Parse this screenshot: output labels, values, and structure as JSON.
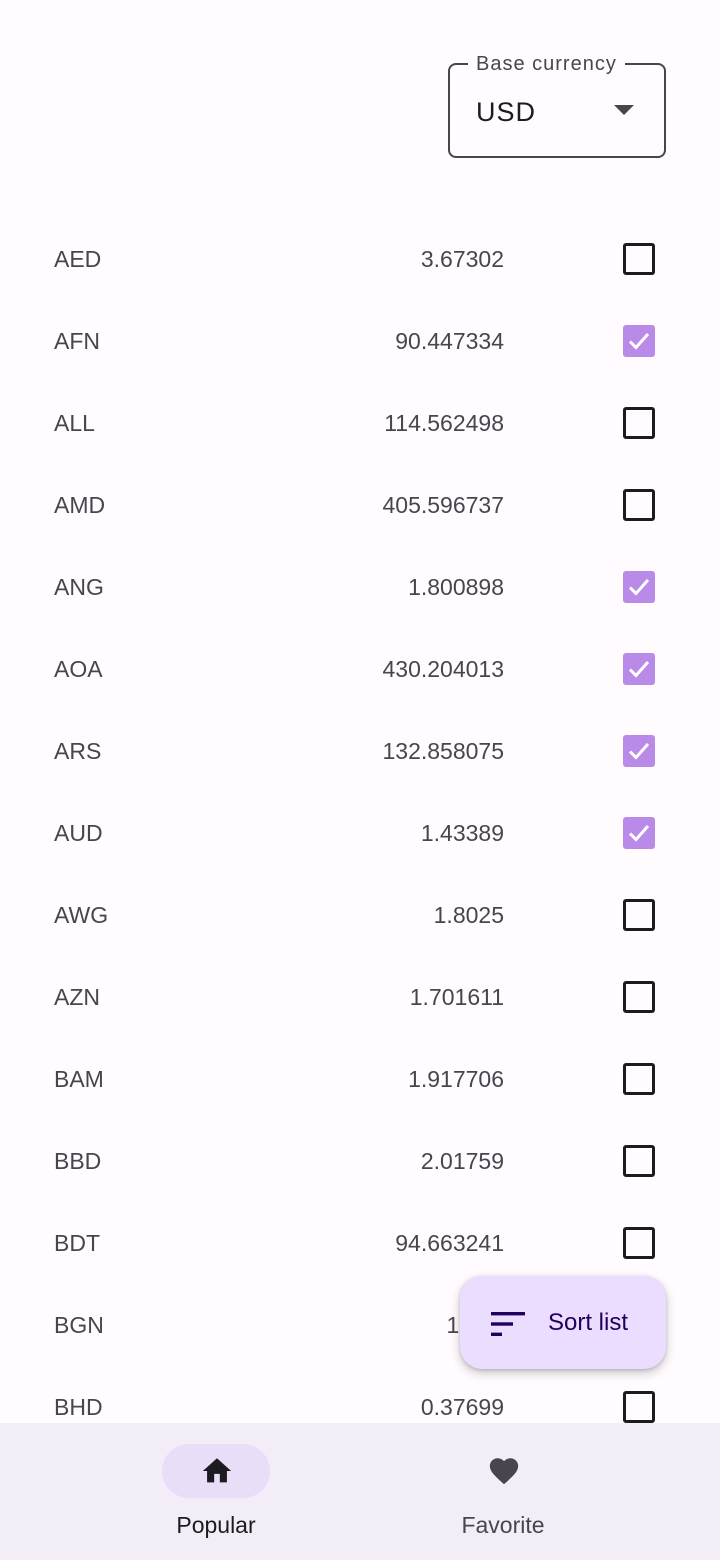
{
  "base_currency": {
    "label": "Base currency",
    "value": "USD"
  },
  "rates": [
    {
      "code": "AED",
      "value": "3.67302",
      "favorite": false
    },
    {
      "code": "AFN",
      "value": "90.447334",
      "favorite": true
    },
    {
      "code": "ALL",
      "value": "114.562498",
      "favorite": false
    },
    {
      "code": "AMD",
      "value": "405.596737",
      "favorite": false
    },
    {
      "code": "ANG",
      "value": "1.800898",
      "favorite": true
    },
    {
      "code": "AOA",
      "value": "430.204013",
      "favorite": true
    },
    {
      "code": "ARS",
      "value": "132.858075",
      "favorite": true
    },
    {
      "code": "AUD",
      "value": "1.43389",
      "favorite": true
    },
    {
      "code": "AWG",
      "value": "1.8025",
      "favorite": false
    },
    {
      "code": "AZN",
      "value": "1.701611",
      "favorite": false
    },
    {
      "code": "BAM",
      "value": "1.917706",
      "favorite": false
    },
    {
      "code": "BBD",
      "value": "2.01759",
      "favorite": false
    },
    {
      "code": "BDT",
      "value": "94.663241",
      "favorite": false
    },
    {
      "code": "BGN",
      "value": "1.919",
      "favorite": false
    },
    {
      "code": "BHD",
      "value": "0.37699",
      "favorite": false
    }
  ],
  "fab": {
    "label": "Sort list",
    "icon": "sort-icon"
  },
  "bottom_nav": {
    "items": [
      {
        "label": "Popular",
        "icon": "home-icon",
        "active": true
      },
      {
        "label": "Favorite",
        "icon": "heart-icon",
        "active": false
      }
    ]
  },
  "colors": {
    "background": "#fffbfe",
    "checkbox_checked": "#b98ae8",
    "fab_background": "#eaddff",
    "nav_background": "#f3edf7",
    "nav_indicator": "#e8def8"
  }
}
